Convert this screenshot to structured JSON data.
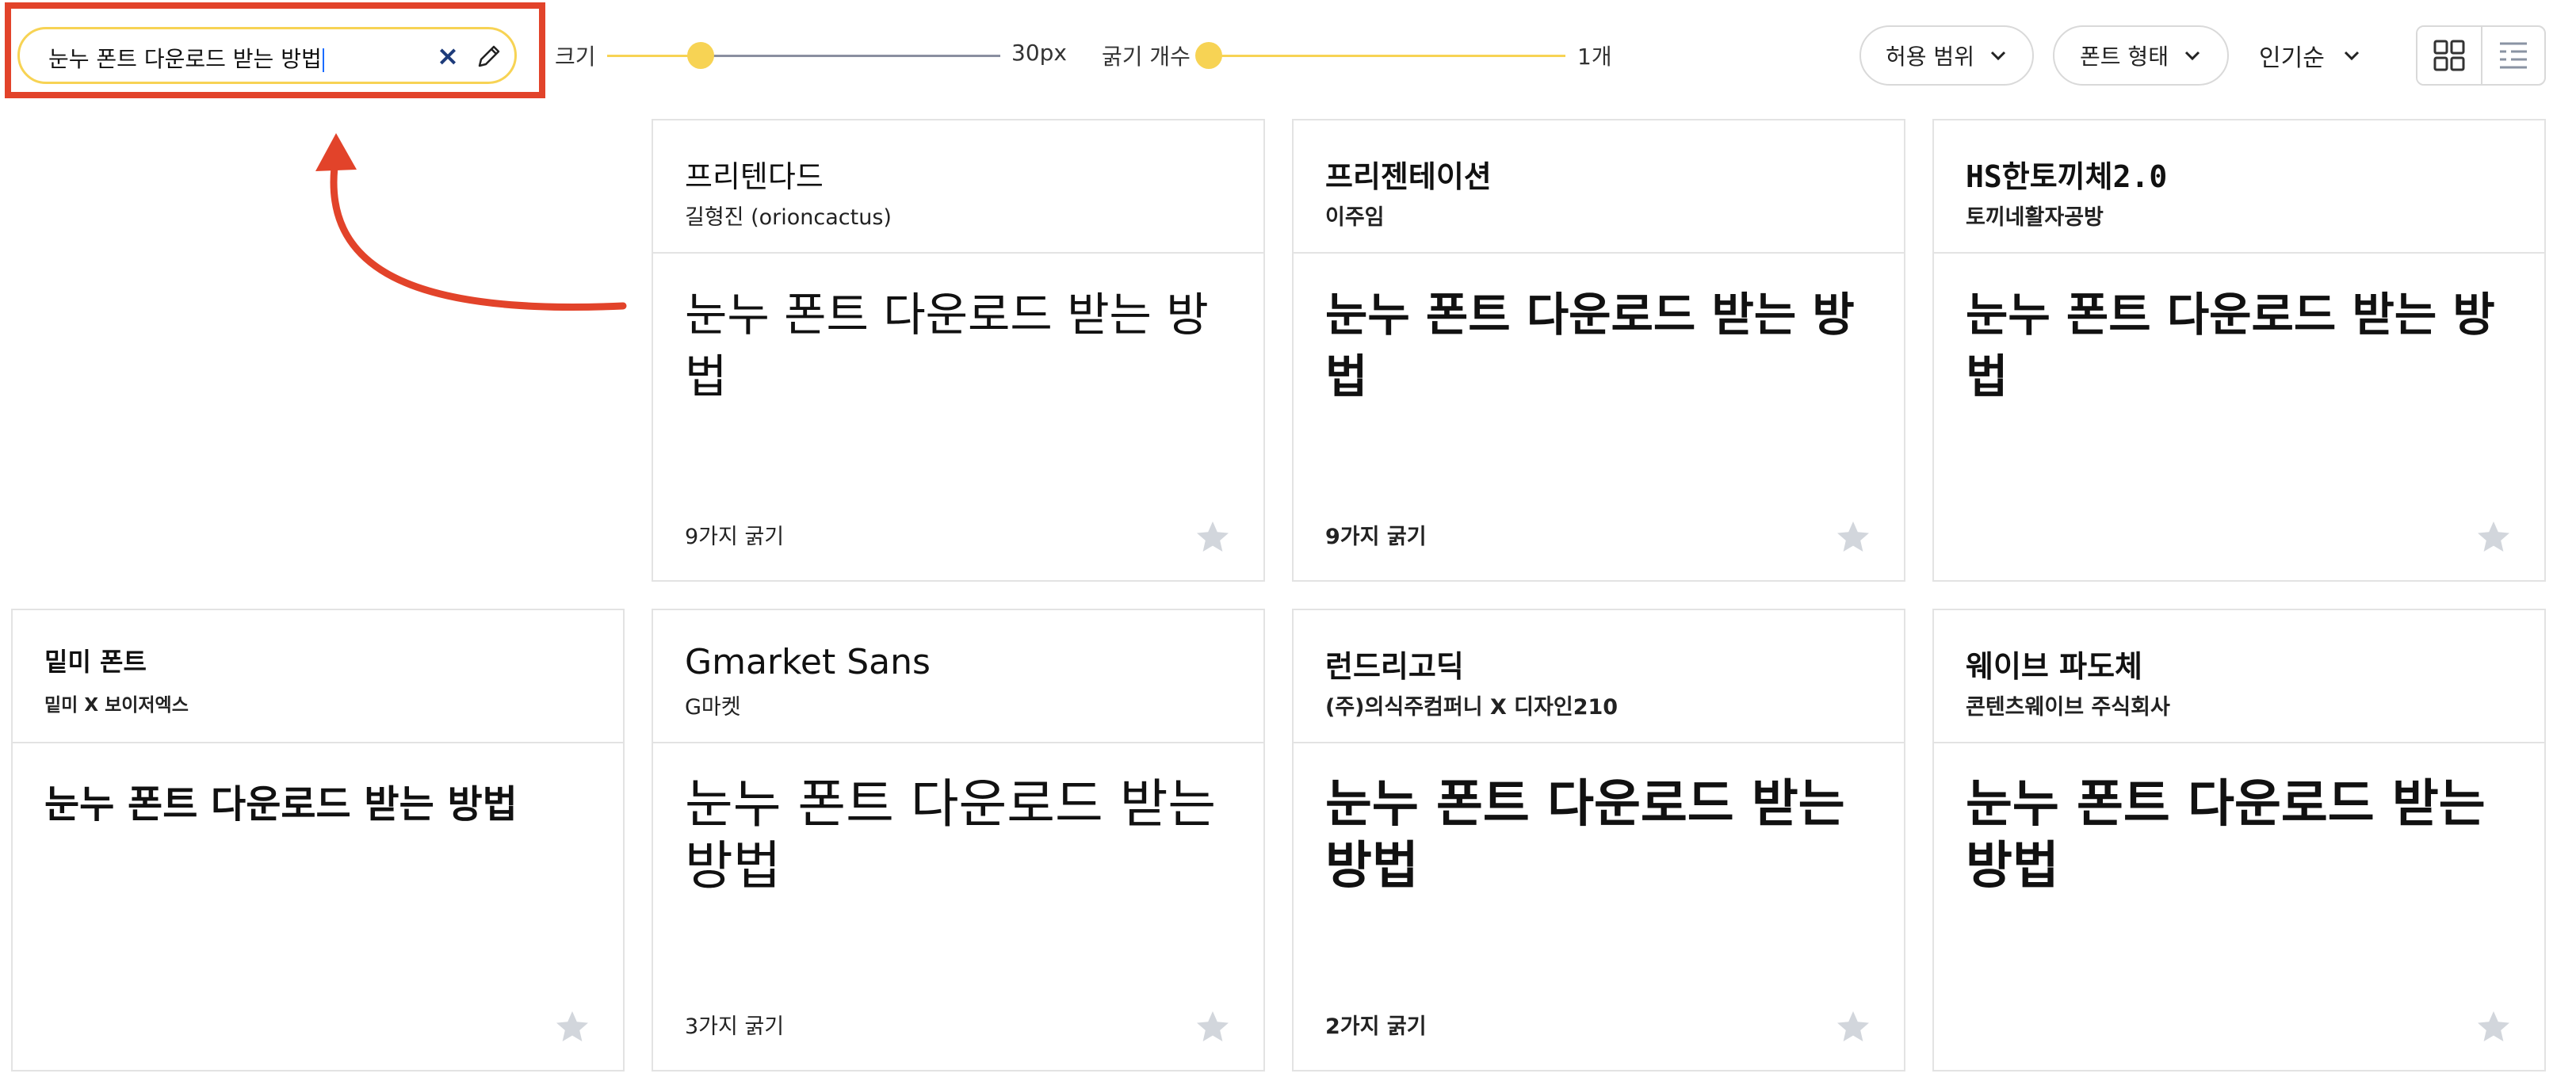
{
  "search": {
    "value": "눈누 폰트 다운로드 받는 방법"
  },
  "size_control": {
    "label": "크기",
    "value_text": "30px"
  },
  "weight_control": {
    "label": "굵기 개수",
    "value_text": "1개"
  },
  "filters": {
    "license_label": "허용 범위",
    "font_type_label": "폰트 형태",
    "sort_label": "인기순"
  },
  "colors": {
    "accent": "#f7d354",
    "annotation": "#e2432a",
    "star": "#d2d6dc"
  },
  "icons": {
    "clear": "close-icon",
    "edit": "pencil-icon",
    "chevron": "chevron-down-icon",
    "grid_view": "grid-view-icon",
    "list_view": "list-view-icon",
    "favorite": "star-icon"
  },
  "cards": [
    {
      "title": "프리텐다드",
      "author": "길형진 (orioncactus)",
      "preview": "눈누 폰트 다운로드 받는 방법",
      "weights": "9가지 굵기"
    },
    {
      "title": "프리젠테이션",
      "author": "이주임",
      "preview": "눈누 폰트 다운로드 받는 방법",
      "weights": "9가지 굵기"
    },
    {
      "title": "HS한토끼체2.0",
      "author": "토끼네활자공방",
      "preview": "눈누 폰트 다운로드 받는 방법",
      "weights": ""
    },
    {
      "title": "밑미 폰트",
      "author": "밑미 X 보이저엑스",
      "preview": "눈누 폰트 다운로드 받는 방법",
      "weights": ""
    },
    {
      "title": "Gmarket Sans",
      "author": "G마켓",
      "preview": "눈누 폰트 다운로드 받는 방법",
      "weights": "3가지 굵기"
    },
    {
      "title": "런드리고딕",
      "author": "(주)의식주컴퍼니 X 디자인210",
      "preview": "눈누 폰트 다운로드 받는 방법",
      "weights": "2가지 굵기"
    },
    {
      "title": "웨이브 파도체",
      "author": "콘텐츠웨이브 주식회사",
      "preview": "눈누 폰트 다운로드 받는 방법",
      "weights": ""
    }
  ]
}
